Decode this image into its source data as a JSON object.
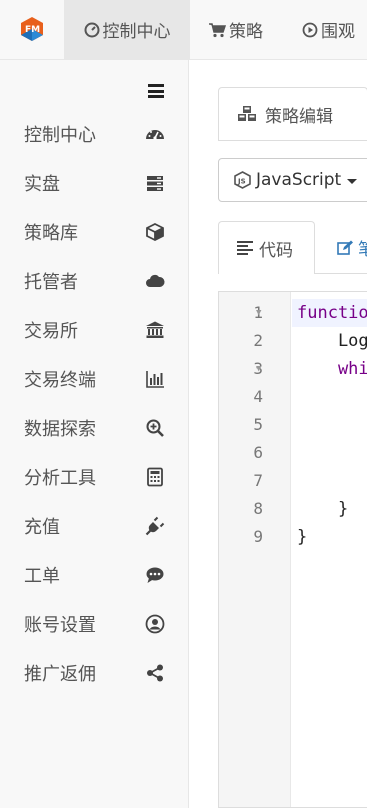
{
  "topnav": {
    "items": [
      {
        "label": "控制中心",
        "icon": "gauge-icon",
        "active": true
      },
      {
        "label": "策略",
        "icon": "cart-icon",
        "active": false
      },
      {
        "label": "围观",
        "icon": "play-circle-icon",
        "active": false
      }
    ]
  },
  "sidebar": {
    "items": [
      {
        "label": "控制中心",
        "icon": "dashboard-icon"
      },
      {
        "label": "实盘",
        "icon": "server-icon"
      },
      {
        "label": "策略库",
        "icon": "cube-icon"
      },
      {
        "label": "托管者",
        "icon": "cloud-icon"
      },
      {
        "label": "交易所",
        "icon": "bank-icon"
      },
      {
        "label": "交易终端",
        "icon": "bar-chart-icon"
      },
      {
        "label": "数据探索",
        "icon": "search-plus-icon"
      },
      {
        "label": "分析工具",
        "icon": "calculator-icon"
      },
      {
        "label": "充值",
        "icon": "plug-icon"
      },
      {
        "label": "工单",
        "icon": "comment-icon"
      },
      {
        "label": "账号设置",
        "icon": "user-circle-icon"
      },
      {
        "label": "推广返佣",
        "icon": "share-icon"
      }
    ]
  },
  "main": {
    "tab_strategy_edit": "策略编辑",
    "language_select": "JavaScript",
    "tab_code": "代码",
    "tab_edit_partial": "笔"
  },
  "editor": {
    "line_numbers": [
      "1",
      "2",
      "3",
      "4",
      "5",
      "6",
      "7",
      "8",
      "9"
    ],
    "lines": [
      {
        "kw": "function",
        "text": ""
      },
      {
        "kw": "",
        "text": "    Log"
      },
      {
        "kw": "    whi",
        "text": ""
      },
      {
        "kw": "",
        "text": ""
      },
      {
        "kw": "",
        "text": ""
      },
      {
        "kw": "",
        "text": ""
      },
      {
        "kw": "",
        "text": ""
      },
      {
        "kw": "",
        "text": "    }"
      },
      {
        "kw": "",
        "text": "}"
      }
    ]
  },
  "colors": {
    "sidebar_bg": "#f8f8f8",
    "link_blue": "#337ab7",
    "keyword": "#770088"
  }
}
